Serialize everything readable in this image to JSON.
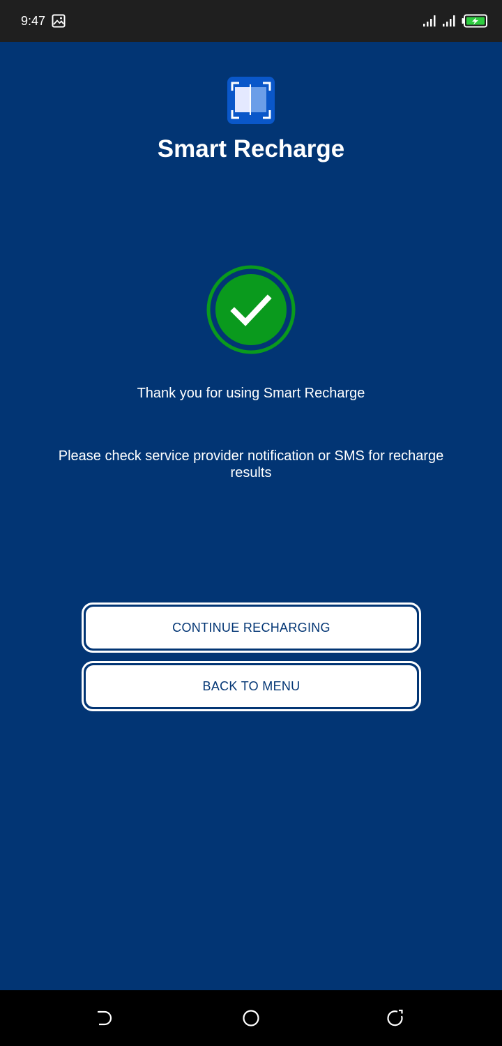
{
  "status_bar": {
    "time": "9:47",
    "icons": [
      "gallery-icon",
      "signal-icon",
      "signal-icon",
      "battery-charging-icon"
    ]
  },
  "app": {
    "title": "Smart Recharge",
    "logo_icon": "smart-card-logo-icon",
    "success_icon": "check-circle-icon"
  },
  "messages": {
    "thank_you": "Thank you for using Smart Recharge",
    "notice": "Please check service provider notification or SMS for recharge results"
  },
  "buttons": {
    "continue_label": "CONTINUE RECHARGING",
    "back_label": "BACK TO MENU"
  },
  "nav": {
    "icons": [
      "back-icon",
      "home-icon",
      "recents-icon"
    ]
  },
  "colors": {
    "background": "#023574",
    "success_green": "#0a9a1d",
    "button_text": "#023574",
    "logo_blue": "#0a57c9"
  }
}
